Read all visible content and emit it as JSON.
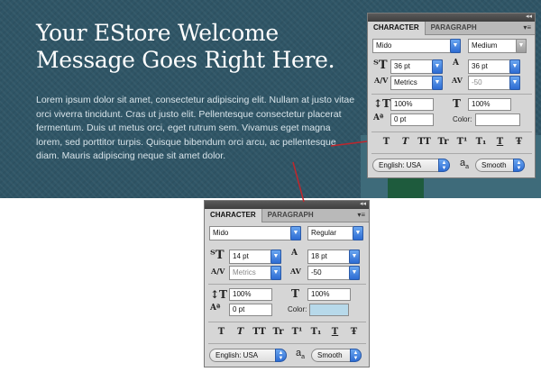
{
  "banner": {
    "headline": "Your EStore Welcome Message Goes Right Here.",
    "body": "Lorem ipsum dolor sit amet, consectetur adipiscing elit. Nullam at justo vitae orci viverra tincidunt. Cras ut justo elit. Pellentesque consectetur placerat fermentum. Duis ut metus orci, eget rutrum sem. Vivamus eget magna lorem, sed porttitor turpis. Quisque bibendum orci arcu, ac pellentesque diam. Mauris adipiscing neque sit amet dolor.",
    "annotation_color": "#c0262c"
  },
  "panel_large": {
    "tab_character": "CHARACTER",
    "tab_paragraph": "PARAGRAPH",
    "font_family": "Mido",
    "font_style": "Medium",
    "font_size": "36 pt",
    "leading": "36 pt",
    "kerning": "Metrics",
    "tracking": "-50",
    "vertical_scale": "100%",
    "horizontal_scale": "100%",
    "baseline_shift": "0 pt",
    "color_label": "Color:",
    "color_value": "#ffffff",
    "language": "English: USA",
    "aa_label": "a",
    "aa_sub": "a",
    "antialias": "Smooth"
  },
  "panel_small": {
    "tab_character": "CHARACTER",
    "tab_paragraph": "PARAGRAPH",
    "font_family": "Mido",
    "font_style": "Regular",
    "font_size": "14 pt",
    "leading": "18 pt",
    "kerning": "Metrics",
    "tracking": "-50",
    "vertical_scale": "100%",
    "horizontal_scale": "100%",
    "baseline_shift": "0 pt",
    "color_label": "Color:",
    "color_value": "#b7d9ea",
    "language": "English: USA",
    "aa_label": "a",
    "aa_sub": "a",
    "antialias": "Smooth"
  },
  "type_styles": [
    "T",
    "T",
    "TT",
    "Tr",
    "T¹",
    "T₁",
    "T",
    "Ŧ"
  ],
  "icons": {
    "font_size": "font-size-icon",
    "leading": "leading-icon",
    "kerning": "kerning-icon",
    "tracking": "tracking-icon",
    "vscale": "vertical-scale-icon",
    "hscale": "horizontal-scale-icon",
    "baseline": "baseline-shift-icon",
    "aa": "anti-alias-icon"
  }
}
